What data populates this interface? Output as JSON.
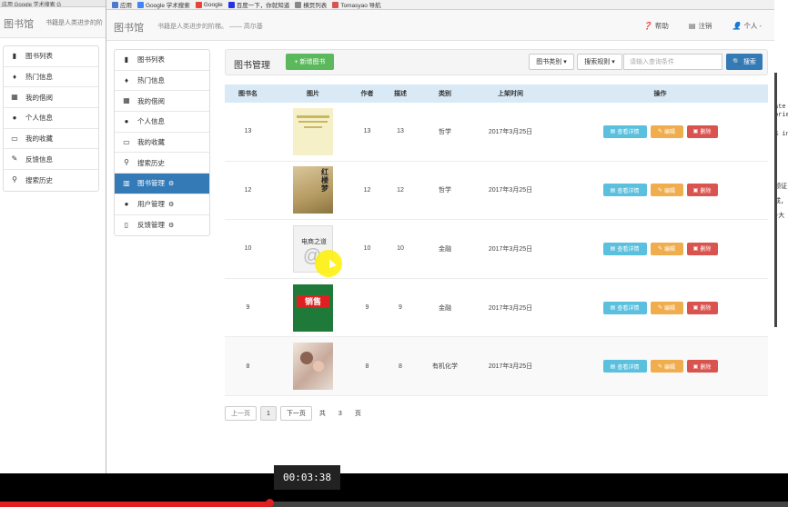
{
  "background_window": {
    "top_strip": "应用   Google 学术搜索   G",
    "brand": "图书馆",
    "tagline": "书籍是人类进步的阶",
    "sidebar": [
      {
        "label": "图书列表",
        "icon": "book-icon"
      },
      {
        "label": "热门信息",
        "icon": "fire-icon"
      },
      {
        "label": "我的借阅",
        "icon": "calendar-icon"
      },
      {
        "label": "个人信息",
        "icon": "user-icon"
      },
      {
        "label": "我的收藏",
        "icon": "folder-icon"
      },
      {
        "label": "反馈信息",
        "icon": "edit-icon"
      },
      {
        "label": "搜索历史",
        "icon": "search-icon"
      }
    ]
  },
  "right_edge_text": [
    "ate",
    "orie",
    "% in",
    "领证",
    "成,",
    "+大",
    "."
  ],
  "bookmarks": [
    {
      "label": "应用",
      "color": "#4a7bd0"
    },
    {
      "label": "Google 学术搜索",
      "color": "#4285f4"
    },
    {
      "label": "Google",
      "color": "#ea4335"
    },
    {
      "label": "百度一下，你就知道",
      "color": "#2932e1"
    },
    {
      "label": "横页列表",
      "color": "#888888"
    },
    {
      "label": "Tomasyao 导航",
      "color": "#d9534f"
    }
  ],
  "navbar": {
    "brand": "图书馆",
    "tagline": "书籍是人类进步的阶梯。 —— 高尔基",
    "help": "帮助",
    "logout": "注销",
    "user": "个人 -"
  },
  "sidebar": [
    {
      "label": "图书列表",
      "icon": "book-icon",
      "active": false,
      "gear": false
    },
    {
      "label": "热门信息",
      "icon": "fire-icon",
      "active": false,
      "gear": false
    },
    {
      "label": "我的借阅",
      "icon": "calendar-icon",
      "active": false,
      "gear": false
    },
    {
      "label": "个人信息",
      "icon": "user-icon",
      "active": false,
      "gear": false
    },
    {
      "label": "我的收藏",
      "icon": "folder-icon",
      "active": false,
      "gear": false
    },
    {
      "label": "搜索历史",
      "icon": "search-icon",
      "active": false,
      "gear": false
    },
    {
      "label": "图书管理",
      "icon": "chart-icon",
      "active": true,
      "gear": true
    },
    {
      "label": "用户管理",
      "icon": "user-icon",
      "active": false,
      "gear": true
    },
    {
      "label": "反馈管理",
      "icon": "file-icon",
      "active": false,
      "gear": true
    }
  ],
  "panel": {
    "title": "图书管理",
    "add_button": "+ 新增图书",
    "category_dropdown": "图书类别 ▾",
    "rule_dropdown": "搜索规则 ▾",
    "search_placeholder": "请输入查询条件",
    "search_button": "搜索"
  },
  "table": {
    "headers": [
      "图书名",
      "图片",
      "作者",
      "描述",
      "类别",
      "上架时间",
      "操作"
    ],
    "rows": [
      {
        "name": "13",
        "author": "13",
        "desc": "13",
        "category": "哲学",
        "date": "2017年3月25日",
        "cover": "pale-yellow-cover"
      },
      {
        "name": "12",
        "author": "12",
        "desc": "12",
        "category": "哲学",
        "date": "2017年3月25日",
        "cover": "hongloumeng-cover"
      },
      {
        "name": "10",
        "author": "10",
        "desc": "10",
        "category": "金融",
        "date": "2017年3月25日",
        "cover": "ecommerce-cover"
      },
      {
        "name": "9",
        "author": "9",
        "desc": "9",
        "category": "金融",
        "date": "2017年3月25日",
        "cover": "sales-cover"
      },
      {
        "name": "8",
        "author": "8",
        "desc": "8",
        "category": "有机化学",
        "date": "2017年3月25日",
        "cover": "mother-child-cover"
      }
    ],
    "action_labels": {
      "detail": "查看详情",
      "edit": "编辑",
      "delete": "删除"
    }
  },
  "cover_texts": {
    "hongloumeng": "红楼梦",
    "ecommerce": "电商之道",
    "sales": "销售"
  },
  "pager": {
    "prev": "上一页",
    "current": "1",
    "next": "下一页",
    "total_prefix": "共",
    "total": "3",
    "total_suffix": "页"
  },
  "video": {
    "time": "00:03:38",
    "progress": 0.34
  }
}
